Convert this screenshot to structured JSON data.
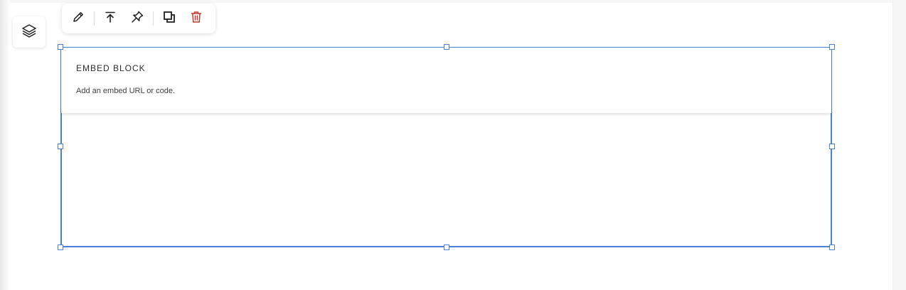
{
  "colors": {
    "selection": "#4a7fd6",
    "delete": "#c0392b",
    "icon": "#1f1f1f"
  },
  "layers_button": {
    "icon": "layers-icon"
  },
  "toolbar": {
    "buttons": [
      {
        "icon": "pencil-icon",
        "action": "edit"
      },
      {
        "icon": "arrow-to-top-icon",
        "action": "move-to-front"
      },
      {
        "icon": "pin-icon",
        "action": "pin"
      },
      {
        "icon": "duplicate-icon",
        "action": "duplicate"
      },
      {
        "icon": "trash-icon",
        "action": "delete"
      }
    ]
  },
  "embed_block": {
    "title": "EMBED BLOCK",
    "hint": "Add an embed URL or code."
  }
}
